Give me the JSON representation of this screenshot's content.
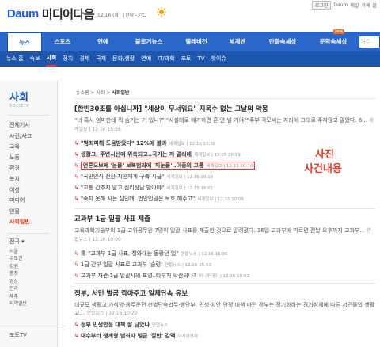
{
  "header": {
    "logo_daum": "Daum",
    "logo_site": "미디어다음",
    "date": "12.16 (화)  |  전남 -3°C",
    "toplinks": [
      "로그인",
      "Daum",
      "메일",
      "카페",
      "블"
    ]
  },
  "nav": {
    "items": [
      "뉴스",
      "스포츠",
      "연예",
      "블로거뉴스",
      "텔레비전",
      "세계엔",
      "만화속세상",
      "문학속세상"
    ],
    "active_index": 0,
    "new_badge": "new",
    "search_placeholder": "뉴스"
  },
  "subnav": {
    "items": [
      "뉴스 홈",
      "속보",
      "사회",
      "정치",
      "경제",
      "국제",
      "문화/생활",
      "연예",
      "IT/과학",
      "포토",
      "TV",
      "핫이슈"
    ],
    "active_index": 2
  },
  "sidebar": {
    "title": "사회",
    "title_en": "SOCIETY",
    "items": [
      "전체기사",
      "사건/사고",
      "교육",
      "노동",
      "환경",
      "복지",
      "여성",
      "미디어",
      "인물",
      "사회일반"
    ],
    "active_index": 9,
    "region_label": "전국",
    "regions": [
      "서울",
      "수도권",
      "강원",
      "충청",
      "경상",
      "전라",
      "제주",
      "지역일반"
    ],
    "footer": "포토TV"
  },
  "breadcrumb": {
    "path": "뉴스홈 > 사회 > ",
    "current": "사회일반"
  },
  "articles": [
    {
      "title": "[한빈30조를 아십니까] \"세상이 무서워요\" 지옥수 없는 그날의 악몽",
      "body": "\"너 혹시 엄마한테 뭐 숨기는 거 있니?\" \"사실대로 얘기하면 혼 안 낼 거야?\"주부 곽모씨는 자리에 그대로 주저앉고 말았다. 6... ",
      "source": "세계일보  |  12.16 15:56",
      "related": [
        {
          "text": "\"범죄피해 도움받았다\" 12%에 불과",
          "meta": "세계일보  |  12.16 15:56"
        },
        {
          "text": "생활고, 주변시선에 위축되고..국가는 저 멀리에",
          "meta": "세계일보  |  12.15 20:11"
        },
        {
          "text": "언론오보에 '눈물' 보복범죄에 '피눈물'..이중의 고통",
          "meta": "세계일보  |  12.15 20:16"
        },
        {
          "text": "\"국민인식 전환·지원체계 구축 시급\"",
          "meta": "세계일보  |  12.15 20:16"
        },
        {
          "text": "\"교통 갑추지 말고 심리상담 받아야\"",
          "meta": "세계일보  |  12.15 16:01"
        },
        {
          "text": "\"죽지 못해 사는 삶인데..법인인권은 보호 해주고\"",
          "meta": "세계일보  |  12.15 20:06"
        }
      ]
    },
    {
      "title": "교과부 1급 일괄 사표 제출",
      "body": "교육과학기술부의 1급 고위공무원 7명이 일괄 사표를 제출한 것으로 알려졌다. 16일 교과부에 따르면 전날 오후까지 교과부... ",
      "source": "연합뉴스  |  12.16 10:00",
      "related": [
        {
          "text": "靑 \"교과부 1급 사표, 청와대는 몰랐던 일\"",
          "meta": "연합뉴스  |  12.16 15:39"
        },
        {
          "text": "1급 간부 일괄 사표로 교과부 '술렁'",
          "meta": "연합뉴스  |  12.16 15:53"
        },
        {
          "text": "교과부 차관·1급 일괄사의 표명..타부처 확산되나?",
          "meta": "머니투데이  |  12.16 10:03"
        }
      ]
    },
    {
      "title": "정부, 서민 벌금 깎아주고 일제단속 유보",
      "body": "대규모 생활고 가석방·음주운전 선별단속법무·행안부, 민생·치안 안정 대책 마련 정부는 장기화하는 경기침체에 따른 서민들의 생활고... ",
      "source": "연합뉴스  |  12.16 10:22",
      "related": [
        {
          "text": "정부 민생안정 대책 잘 담았나",
          "meta": "연합뉴스"
        },
        {
          "text": "내수부터 생계형 범죄자 벌금 '절반' 감액",
          "meta": "아시아경제"
        }
      ]
    }
  ],
  "annotations": {
    "line1": "사진",
    "line2": "사건내용",
    "color": "#e33a2a"
  }
}
